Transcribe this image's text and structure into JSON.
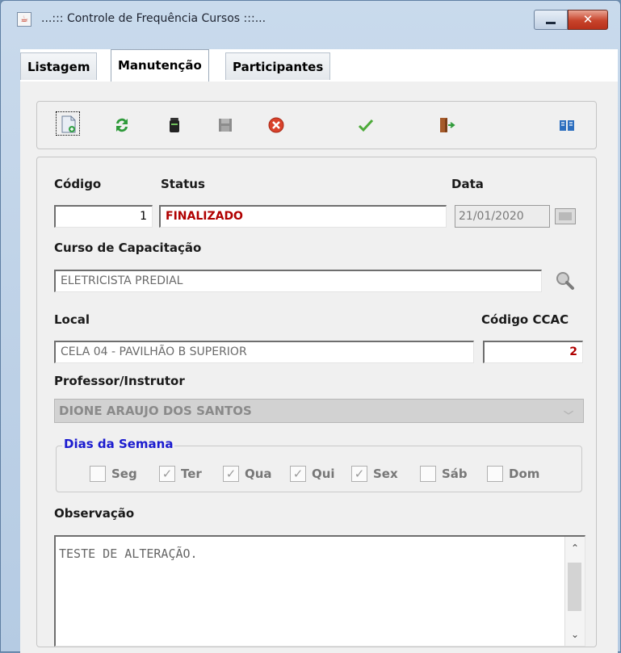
{
  "window": {
    "title": "...::: Controle de Frequência Cursos :::...",
    "close_glyph": "✕"
  },
  "tabs": [
    {
      "label": "Listagem",
      "active": false
    },
    {
      "label": "Manutenção",
      "active": true
    },
    {
      "label": "Participantes",
      "active": false
    }
  ],
  "toolbar": {
    "icons": [
      "new-document-icon",
      "refresh-icon",
      "delete-trash-icon",
      "save-disk-icon",
      "cancel-circle-icon",
      "confirm-check-icon",
      "exit-door-icon",
      "help-book-icon"
    ]
  },
  "form": {
    "codigo": {
      "label": "Código",
      "value": "1"
    },
    "status": {
      "label": "Status",
      "value": "FINALIZADO"
    },
    "data": {
      "label": "Data",
      "value": "21/01/2020"
    },
    "curso": {
      "label": "Curso de Capacitação",
      "value": "ELETRICISTA PREDIAL"
    },
    "local": {
      "label": "Local",
      "value": "CELA 04 - PAVILHÃO B SUPERIOR"
    },
    "codigo_ccac": {
      "label": "Código CCAC",
      "value": "2"
    },
    "professor": {
      "label": "Professor/Instrutor",
      "value": "DIONE ARAUJO DOS SANTOS"
    },
    "dias": {
      "title": "Dias da Semana",
      "items": [
        {
          "label": "Seg",
          "checked": false
        },
        {
          "label": "Ter",
          "checked": true
        },
        {
          "label": "Qua",
          "checked": true
        },
        {
          "label": "Qui",
          "checked": true
        },
        {
          "label": "Sex",
          "checked": true
        },
        {
          "label": "Sáb",
          "checked": false
        },
        {
          "label": "Dom",
          "checked": false
        }
      ]
    },
    "observacao": {
      "label": "Observação",
      "value": "TESTE DE ALTERAÇÃO."
    }
  },
  "colors": {
    "accent_red": "#b00000",
    "group_title_blue": "#1b1bcf"
  }
}
